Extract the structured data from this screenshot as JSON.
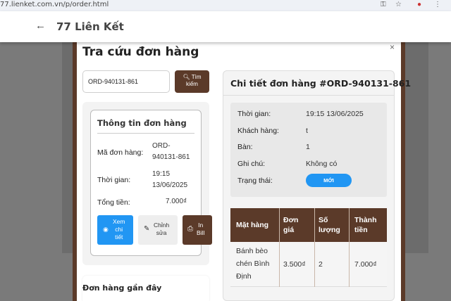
{
  "browser": {
    "url": "77.lienket.com.vn/p/order.html"
  },
  "header": {
    "back_icon": "arrow-left-icon",
    "title": "77 Liên Kết"
  },
  "modal": {
    "title": "Tra cứu đơn hàng",
    "close_label": "×"
  },
  "search": {
    "value": "ORD-940131-861",
    "button_line1": "Tìm",
    "button_line2": "kiếm"
  },
  "order_info": {
    "title": "Thông tin đơn hàng",
    "code_label": "Mã đơn hàng:",
    "code_line1": "ORD-",
    "code_line2": "940131-861",
    "time_label": "Thời gian:",
    "time_line1": "19:15",
    "time_line2": "13/06/2025",
    "total_label": "Tổng tiền:",
    "total_value": "7.000₫",
    "view_line1": "Xem",
    "view_line2": "chi",
    "view_line3": "tiết",
    "edit_line1": "Chỉnh",
    "edit_line2": "sửa",
    "print_line1": "In",
    "print_line2": "Bill"
  },
  "recent": {
    "title": "Đơn hàng gần đây"
  },
  "detail": {
    "title": "Chi tiết đơn hàng #ORD-940131-861",
    "time_label": "Thời gian:",
    "time_value": "19:15 13/06/2025",
    "customer_label": "Khách hàng:",
    "customer_value": "t",
    "table_label": "Bàn:",
    "table_value": "1",
    "note_label": "Ghi chú:",
    "note_value": "Không có",
    "status_label": "Trạng thái:",
    "status_value": "MỚI",
    "status_color": "#2196f3"
  },
  "items_table": {
    "headers": [
      "Mặt hàng",
      "Đơn giá",
      "Số lượng",
      "Thành tiền"
    ],
    "header_lines": [
      [
        "Mặt hàng"
      ],
      [
        "Đơn",
        "giá"
      ],
      [
        "Số",
        "lượng"
      ],
      [
        "Thành",
        "tiền"
      ]
    ],
    "rows": [
      {
        "name_lines": [
          "Bánh bèo",
          "chén Bình",
          "Định"
        ],
        "price": "3.500₫",
        "qty": "2",
        "total": "7.000₫"
      }
    ]
  },
  "colors": {
    "brand": "#5b3a29",
    "primary": "#2196f3"
  }
}
